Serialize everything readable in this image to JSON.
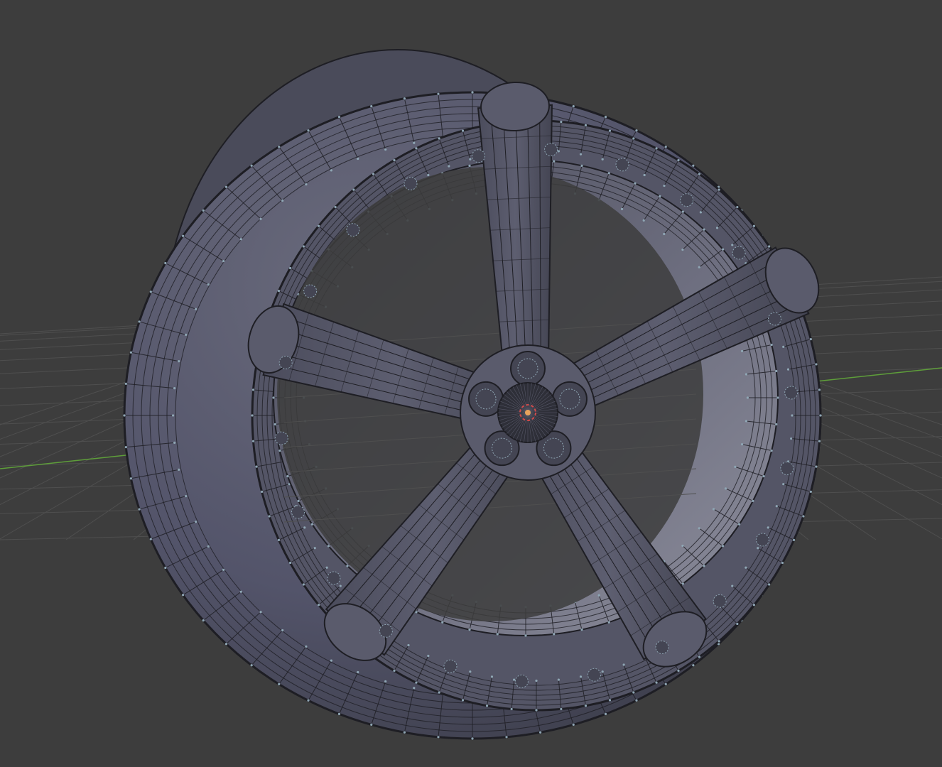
{
  "viewport": {
    "background": "#3d3d3d",
    "grid_color": "#4f4f4f",
    "x_axis_color": "#b34a4a",
    "y_axis_color": "#5e9e3a",
    "mesh": {
      "face_color": "#5a5b6c",
      "face_dark": "#444553",
      "edge_color": "#1e1e24",
      "vertex_color": "#8fa6b4",
      "spoke_count": 5,
      "lug_count": 5
    },
    "origin_marker": {
      "icon": "object-origin-icon",
      "color": "#e8a25c",
      "ring_color": "#d14b4b"
    }
  }
}
